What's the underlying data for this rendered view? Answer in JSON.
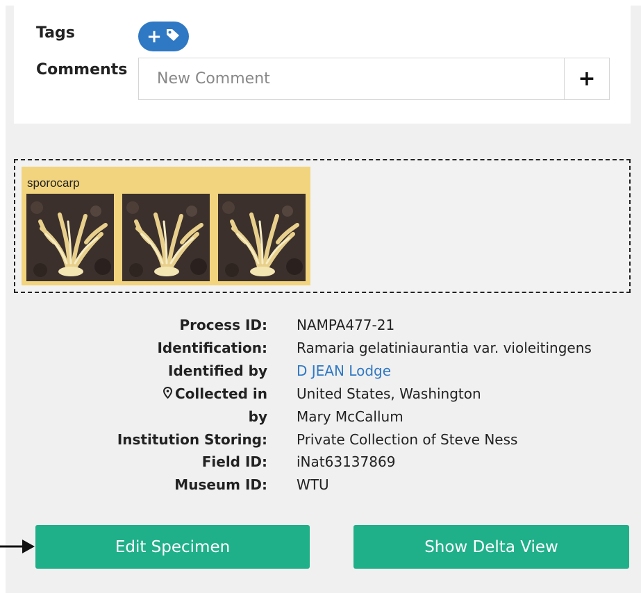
{
  "tags": {
    "label": "Tags"
  },
  "comments": {
    "label": "Comments",
    "placeholder": "New Comment",
    "add_label": "+"
  },
  "images": {
    "group_title": "sporocarp",
    "thumbnails": [
      {
        "alt": "sporocarp photo 1"
      },
      {
        "alt": "sporocarp photo 2"
      },
      {
        "alt": "sporocarp photo 3"
      }
    ]
  },
  "details": [
    {
      "key": "Process ID:",
      "value": "NAMPA477-21"
    },
    {
      "key": "Identification:",
      "value": "Ramaria gelatiniaurantia var. violeitingens"
    },
    {
      "key": "Identified by",
      "value": "D JEAN Lodge",
      "link": true
    },
    {
      "key": "Collected in",
      "value": "United States, Washington",
      "icon": "map-pin-icon"
    },
    {
      "key": "by",
      "value": "Mary McCallum"
    },
    {
      "key": "Institution Storing:",
      "value": "Private Collection of Steve Ness"
    },
    {
      "key": "Field ID:",
      "value": "iNat63137869"
    },
    {
      "key": "Museum ID:",
      "value": "WTU"
    }
  ],
  "actions": {
    "edit_label": "Edit Specimen",
    "delta_label": "Show Delta View"
  },
  "colors": {
    "primary": "#2f78c4",
    "action": "#20b089",
    "group_bg": "#f2d47e"
  }
}
